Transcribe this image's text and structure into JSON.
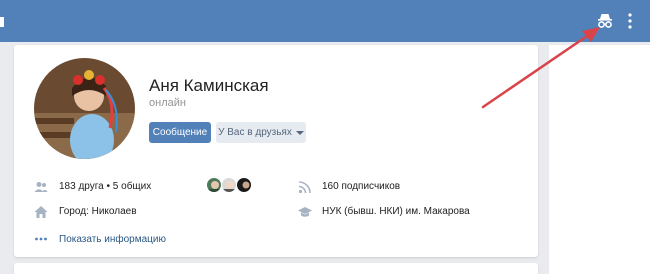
{
  "header": {
    "icons": [
      "incognito-icon",
      "more-vertical-icon"
    ]
  },
  "profile": {
    "name": "Аня Каминская",
    "status": "онлайн",
    "message_button": "Сообщение",
    "friend_button": "У Вас в друзьях"
  },
  "info": {
    "friends": "183 друга • 5 общих",
    "subscribers": "160 подписчиков",
    "city": "Город: Николаев",
    "education": "НУК (бывш. НКИ) им. Макарова",
    "show_more": "Показать информацию"
  },
  "colors": {
    "header": "#5181b8",
    "accent_button": "#5181b8",
    "link": "#2a5885",
    "annotation_arrow": "#d9444a"
  }
}
